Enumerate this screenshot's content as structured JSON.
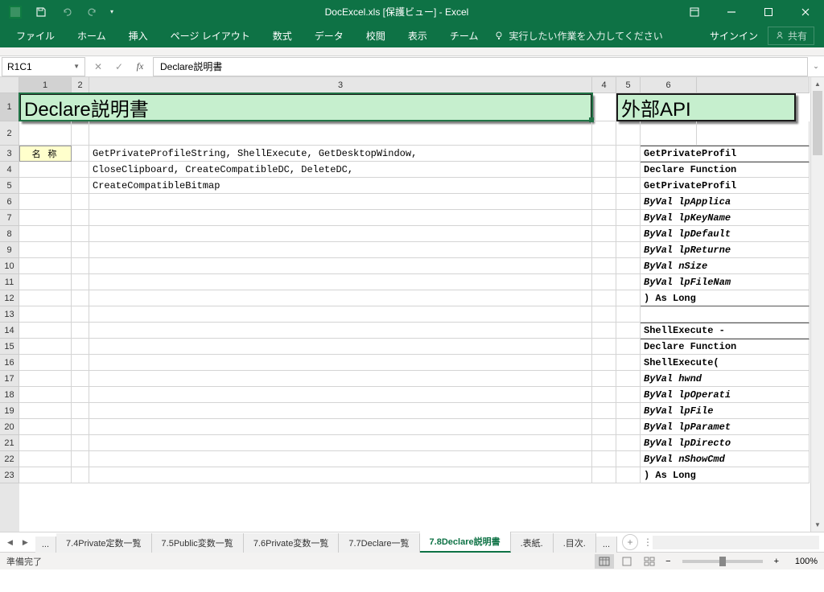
{
  "window": {
    "title": "DocExcel.xls  [保護ビュー] - Excel"
  },
  "ribbon": {
    "tabs": [
      "ファイル",
      "ホーム",
      "挿入",
      "ページ レイアウト",
      "数式",
      "データ",
      "校閲",
      "表示",
      "チーム"
    ],
    "tell_me": "実行したい作業を入力してください",
    "signin": "サインイン",
    "share": "共有"
  },
  "formula_bar": {
    "name_box": "R1C1",
    "formula": "Declare説明書"
  },
  "columns": [
    "1",
    "2",
    "3",
    "4",
    "5",
    "6"
  ],
  "rows": [
    "1",
    "2",
    "3",
    "4",
    "5",
    "6",
    "7",
    "8",
    "9",
    "10",
    "11",
    "12",
    "13",
    "14",
    "15",
    "16",
    "17",
    "18",
    "19",
    "20",
    "21",
    "22",
    "23"
  ],
  "cells": {
    "title1": "Declare説明書",
    "title2": "外部API",
    "label_name": "名 称",
    "r3c3": "GetPrivateProfileString, ShellExecute, GetDesktopWindow,",
    "r4c3": "CloseClipboard, CreateCompatibleDC, DeleteDC,",
    "r5c3": "CreateCompatibleBitmap",
    "api": {
      "r3": "GetPrivateProfil",
      "r4": "Declare Function",
      "r5": "GetPrivateProfil",
      "r6": "  ByVal lpApplica",
      "r7": "  ByVal lpKeyName",
      "r8": "  ByVal lpDefault",
      "r9": "  ByVal lpReturne",
      "r10": "  ByVal nSize",
      "r11": "  ByVal lpFileNam",
      "r12": ") As Long",
      "r14": "ShellExecute - ",
      "r15": "Declare Function",
      "r16": "ShellExecute(",
      "r17": "  ByVal hwnd",
      "r18": "  ByVal lpOperati",
      "r19": "  ByVal lpFile",
      "r20": "  ByVal lpParamet",
      "r21": "  ByVal lpDirecto",
      "r22": "  ByVal nShowCmd",
      "r23": ") As Long"
    }
  },
  "tabs": {
    "nav_ellipsis": "...",
    "list": [
      "7.4Private定数一覧",
      "7.5Public変数一覧",
      "7.6Private変数一覧",
      "7.7Declare一覧",
      "7.8Declare説明書",
      ".表紙.",
      ".目次."
    ],
    "active_index": 4,
    "more": "..."
  },
  "statusbar": {
    "status": "準備完了",
    "zoom_minus": "−",
    "zoom_plus": "+",
    "zoom": "100%"
  }
}
